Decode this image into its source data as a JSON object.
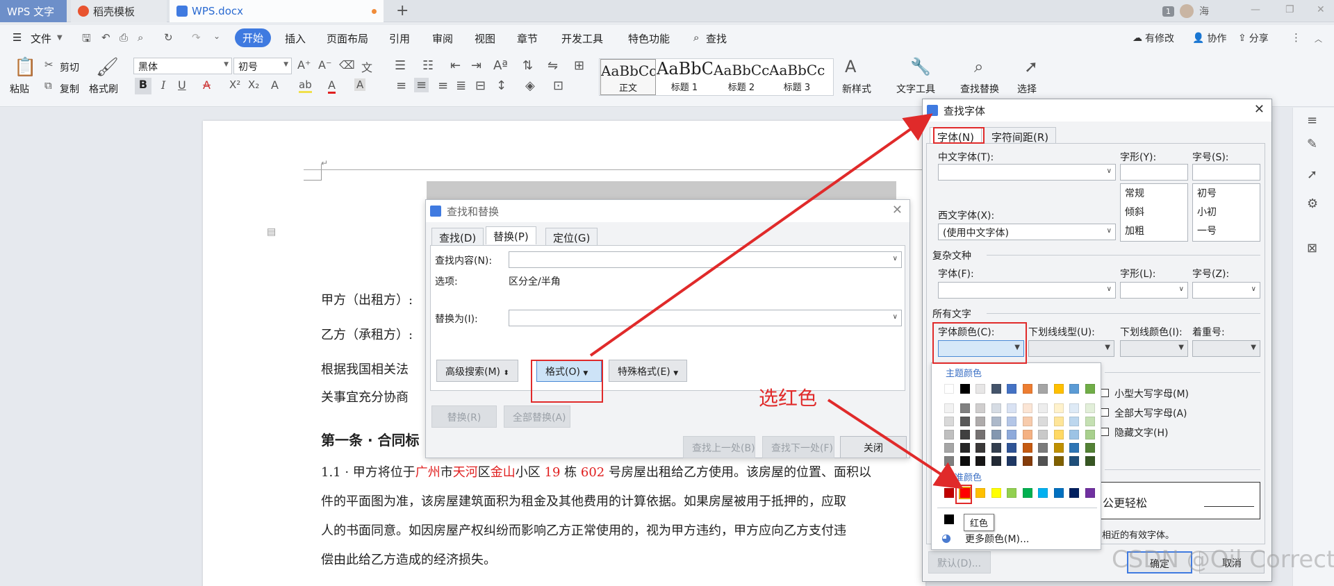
{
  "tabs": {
    "wps": "WPS 文字",
    "daoke": "稻壳模板",
    "doc": "WPS.docx"
  },
  "titlebar": {
    "badge": "1",
    "user": "海"
  },
  "menu": {
    "file": "文件",
    "items": [
      "开始",
      "插入",
      "页面布局",
      "引用",
      "审阅",
      "视图",
      "章节",
      "开发工具",
      "特色功能"
    ],
    "search": "查找",
    "right": {
      "modify": "有修改",
      "collab": "协作",
      "share": "分享"
    }
  },
  "ribbon": {
    "paste": "粘贴",
    "cut": "剪切",
    "copy": "复制",
    "format_painter": "格式刷",
    "font": "黑体",
    "size": "初号",
    "styles": [
      {
        "preview": "AaBbCcDd",
        "name": "正文"
      },
      {
        "preview": "AaBbC",
        "name": "标题 1"
      },
      {
        "preview": "AaBbCcD",
        "name": "标题 2"
      },
      {
        "preview": "AaBbCcD",
        "name": "标题 3"
      }
    ],
    "new_style": "新样式",
    "text_tools": "文字工具",
    "find_replace": "查找替换",
    "select": "选择"
  },
  "doc": {
    "party_a": "甲方（出租方）:",
    "party_b": "乙方（承租方）:",
    "para1": "根据我国相关法",
    "para1b": "关事宜充分协商",
    "heading": "第一条 · 合同标",
    "clause": {
      "p1": "1.1 · 甲方将位于",
      "city": "广州",
      "s2": "市",
      "district": "天河",
      "s3": "区",
      "area": "金山",
      "s4": "小区 ",
      "bld": "19",
      "s5": " 栋 ",
      "room": "602",
      "s6": " 号房屋出租给乙方使用。该房屋的位置、面积以"
    },
    "line2": "件的平面图为准，该房屋建筑面积为租金及其他费用的计算依据。如果房屋被用于抵押的，应取",
    "line3": "人的书面同意。如因房屋产权纠纷而影响乙方正常使用的，视为甲方违约，甲方应向乙方支付违",
    "line4": "偿由此给乙方造成的经济损失。",
    "frag_right": "房"
  },
  "find_replace": {
    "title": "查找和替换",
    "tabs": [
      "查找(D)",
      "替换(P)",
      "定位(G)"
    ],
    "find_label": "查找内容(N):",
    "options_label": "选项:",
    "options_value": "区分全/半角",
    "replace_label": "替换为(I):",
    "advanced": "高级搜索(M)",
    "format": "格式(O)",
    "special": "特殊格式(E)",
    "replace": "替换(R)",
    "replace_all": "全部替换(A)",
    "find_prev": "查找上一处(B)",
    "find_next": "查找下一处(F)",
    "close": "关闭"
  },
  "find_font": {
    "title": "查找字体",
    "tabs": [
      "字体(N)",
      "字符间距(R)"
    ],
    "cn_font": "中文字体(T):",
    "style": "字形(Y):",
    "size": "字号(S):",
    "styles": [
      "常规",
      "倾斜",
      "加粗"
    ],
    "sizes": [
      "初号",
      "小初",
      "一号"
    ],
    "west_font": "西文字体(X):",
    "west_value": "(使用中文字体)",
    "complex": "复杂文种",
    "c_font": "字体(F):",
    "c_style": "字形(L):",
    "c_size": "字号(Z):",
    "all_text": "所有文字",
    "font_color": "字体颜色(C):",
    "underline": "下划线线型(U):",
    "underline_color": "下划线颜色(I):",
    "emphasis": "着重号:",
    "effects_frag": "效",
    "small_caps": "小型大写字母(M)",
    "all_caps": "全部大写字母(A)",
    "hidden": "隐藏文字(H)",
    "preview_text": "公更轻松",
    "note": "相近的有效字体。",
    "default": "默认(D)...",
    "ok": "确定",
    "cancel": "取消"
  },
  "palette": {
    "theme": "主题颜色",
    "standard": "标准颜色",
    "tooltip": "红色",
    "more": "更多颜色(M)...",
    "top_row": [
      "#ffffff",
      "#000000",
      "#e7e6e6",
      "#44546a",
      "#4472c4",
      "#ed7d31",
      "#a5a5a5",
      "#ffc000",
      "#5b9bd5",
      "#70ad47"
    ],
    "shade_cols": [
      [
        "#f2f2f2",
        "#d9d9d9",
        "#bfbfbf",
        "#a6a6a6",
        "#808080"
      ],
      [
        "#808080",
        "#595959",
        "#404040",
        "#262626",
        "#0d0d0d"
      ],
      [
        "#d0cece",
        "#aeabab",
        "#757171",
        "#3a3838",
        "#171616"
      ],
      [
        "#d6dce4",
        "#adb9ca",
        "#8497b0",
        "#333f4f",
        "#222a35"
      ],
      [
        "#d9e2f3",
        "#b4c6e7",
        "#8eaadb",
        "#2f5496",
        "#1f3864"
      ],
      [
        "#fbe5d5",
        "#f7cbac",
        "#f4b183",
        "#c55a11",
        "#843c0b"
      ],
      [
        "#ededed",
        "#dbdbdb",
        "#c9c9c9",
        "#7b7b7b",
        "#525252"
      ],
      [
        "#fff2cc",
        "#fee599",
        "#ffd965",
        "#bf9000",
        "#7f6000"
      ],
      [
        "#deeaf6",
        "#bdd7ee",
        "#9cc3e5",
        "#2e75b5",
        "#1f4e79"
      ],
      [
        "#e2efd9",
        "#c5e0b3",
        "#a8d08d",
        "#538135",
        "#375623"
      ]
    ],
    "std_colors": [
      "#c00000",
      "#ff0000",
      "#ffc000",
      "#ffff00",
      "#92d050",
      "#00b050",
      "#00b0f0",
      "#0070c0",
      "#002060",
      "#7030a0"
    ]
  },
  "annotation": {
    "label": "选红色",
    "color": "#e02a2a"
  },
  "watermark": "CSDN @Oil Correct"
}
